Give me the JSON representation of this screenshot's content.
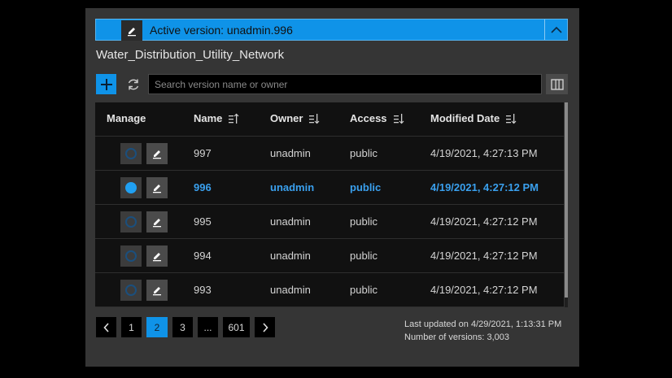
{
  "active_version": {
    "label": "Active version: unadmin.996"
  },
  "network_name": "Water_Distribution_Utility_Network",
  "toolbar": {
    "search_placeholder": "Search version name or owner"
  },
  "table": {
    "headers": {
      "manage": "Manage",
      "name": "Name",
      "owner": "Owner",
      "access": "Access",
      "modified": "Modified Date"
    },
    "rows": [
      {
        "name": "997",
        "owner": "unadmin",
        "access": "public",
        "modified": "4/19/2021, 4:27:13 PM",
        "active": false
      },
      {
        "name": "996",
        "owner": "unadmin",
        "access": "public",
        "modified": "4/19/2021, 4:27:12 PM",
        "active": true
      },
      {
        "name": "995",
        "owner": "unadmin",
        "access": "public",
        "modified": "4/19/2021, 4:27:12 PM",
        "active": false
      },
      {
        "name": "994",
        "owner": "unadmin",
        "access": "public",
        "modified": "4/19/2021, 4:27:12 PM",
        "active": false
      },
      {
        "name": "993",
        "owner": "unadmin",
        "access": "public",
        "modified": "4/19/2021, 4:27:12 PM",
        "active": false
      }
    ]
  },
  "pagination": {
    "pages": [
      "1",
      "2",
      "3",
      "...",
      "601"
    ],
    "current_page": "2"
  },
  "status": {
    "last_updated": "Last updated on 4/29/2021, 1:13:31 PM",
    "version_count": "Number of versions: 3,003"
  },
  "colors": {
    "accent": "#0f93e8",
    "active_row_text": "#3aa0ee",
    "panel": "#353535"
  },
  "icons": [
    "pencil-icon",
    "chevron-up-icon",
    "plus-icon",
    "refresh-icon",
    "columns-icon",
    "sort-icon",
    "radio-icon",
    "chevron-left-icon",
    "chevron-right-icon"
  ]
}
